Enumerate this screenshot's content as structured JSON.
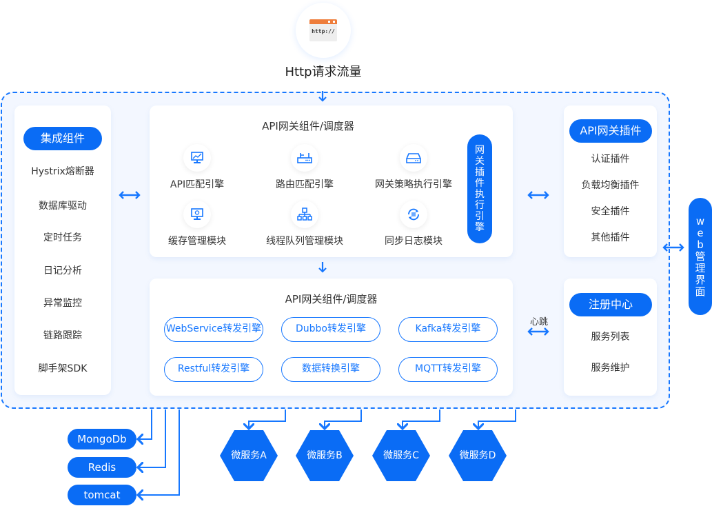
{
  "http": {
    "icon": "browser-http-icon",
    "icon_text": "http://",
    "label": "Http请求流量"
  },
  "colors": {
    "accent": "#0a6cf5",
    "background": "#f3f7ff",
    "http_bar": "#ee7d3b"
  },
  "integration": {
    "title": "集成组件",
    "items": [
      "Hystrix熔断器",
      "数据库驱动",
      "定时任务",
      "日记分析",
      "异常监控",
      "链路跟踪",
      "脚手架SDK"
    ]
  },
  "scheduler": {
    "title": "API网关组件/调度器",
    "features": [
      {
        "label": "API匹配引擎",
        "icon": "monitor-chart-icon"
      },
      {
        "label": "路由匹配引擎",
        "icon": "router-icon"
      },
      {
        "label": "网关策略执行引擎",
        "icon": "server-drive-icon"
      },
      {
        "label": "缓存管理模块",
        "icon": "monitor-refresh-icon"
      },
      {
        "label": "线程队列管理模块",
        "icon": "hierarchy-icon"
      },
      {
        "label": "同步日志模块",
        "icon": "sync-log-icon"
      }
    ],
    "plugin_engine": "网关插件执行引擎"
  },
  "forwarder": {
    "title": "API网关组件/调度器",
    "engines": [
      "WebService转发引擎",
      "Dubbo转发引擎",
      "Kafka转发引擎",
      "Restful转发引擎",
      "数据转换引擎",
      "MQTT转发引擎"
    ]
  },
  "plugins": {
    "title": "API网关插件",
    "items": [
      "认证插件",
      "负载均衡插件",
      "安全插件",
      "其他插件"
    ]
  },
  "registry": {
    "title": "注册中心",
    "heartbeat": "心跳",
    "items": [
      "服务列表",
      "服务维护"
    ]
  },
  "web_admin": "web管理界面",
  "stores": [
    "MongoDb",
    "Redis",
    "tomcat"
  ],
  "microservices": [
    "微服务A",
    "微服务B",
    "微服务C",
    "微服务D"
  ]
}
